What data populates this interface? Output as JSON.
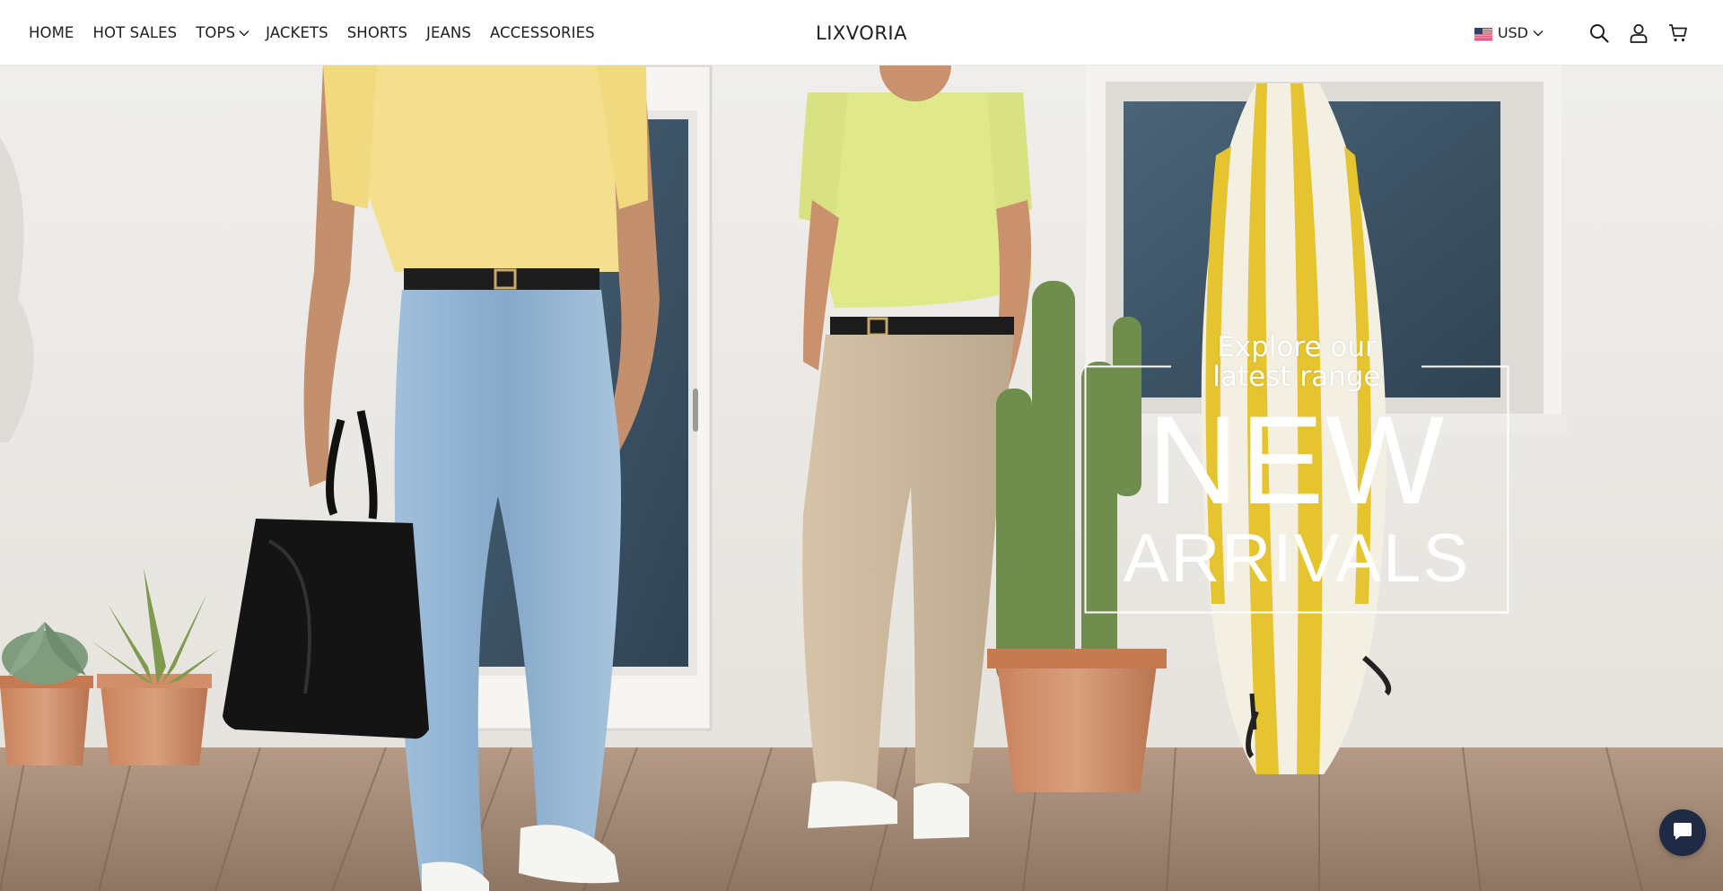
{
  "brand": {
    "name": "LIXVORIA"
  },
  "nav": {
    "items": [
      {
        "label": "HOME",
        "has_dropdown": false
      },
      {
        "label": "HOT SALES",
        "has_dropdown": false
      },
      {
        "label": "TOPS",
        "has_dropdown": true
      },
      {
        "label": "JACKETS",
        "has_dropdown": false
      },
      {
        "label": "SHORTS",
        "has_dropdown": false
      },
      {
        "label": "JEANS",
        "has_dropdown": false
      },
      {
        "label": "ACCESSORIES",
        "has_dropdown": false
      }
    ]
  },
  "utilities": {
    "currency": {
      "label": "USD",
      "flag_icon": "us-flag-icon"
    },
    "search_icon": "search-icon",
    "account_icon": "user-icon",
    "cart_icon": "cart-icon"
  },
  "hero": {
    "subtitle_line1": "Explore our",
    "subtitle_line2": "latest range",
    "headline": "NEW",
    "headline2": "ARRIVALS",
    "text_color": "#ffffff"
  },
  "chat": {
    "icon": "chat-icon",
    "color": "#1f2a44"
  }
}
